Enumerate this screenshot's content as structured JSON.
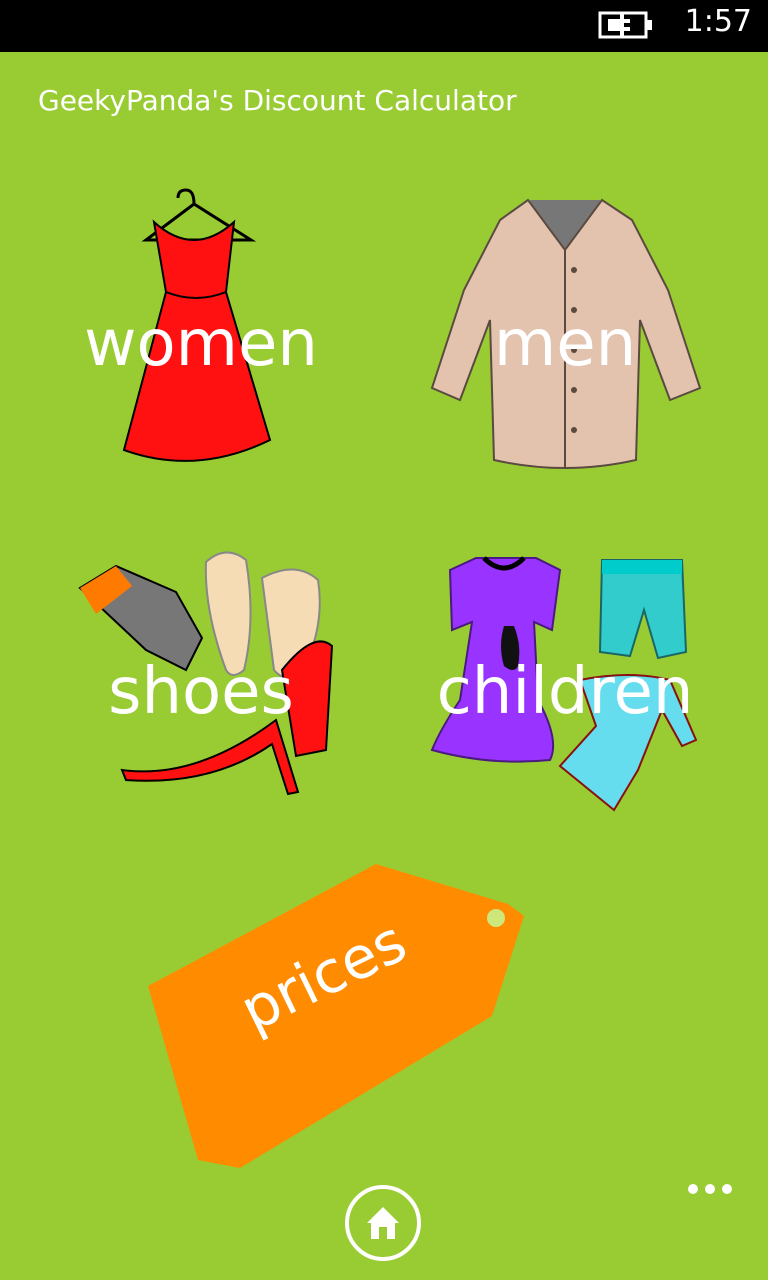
{
  "status_bar": {
    "time": "1:57",
    "battery_icon": "battery-charging-icon"
  },
  "app": {
    "title": "GeekyPanda's Discount Calculator"
  },
  "categories": [
    {
      "label": "women",
      "icon": "dress-icon"
    },
    {
      "label": "men",
      "icon": "shirt-icon"
    },
    {
      "label": "shoes",
      "icon": "shoes-icon"
    },
    {
      "label": "children",
      "icon": "children-clothes-icon"
    }
  ],
  "prices": {
    "label": "prices",
    "icon": "price-tag-icon"
  },
  "app_bar": {
    "home_icon": "home-icon",
    "more_icon": "more-dots-icon"
  },
  "colors": {
    "background": "#99cc33",
    "tag": "#ff8c00",
    "dress": "#ff1111",
    "shirt": "#e3c2ae",
    "status_bar": "#000000"
  }
}
